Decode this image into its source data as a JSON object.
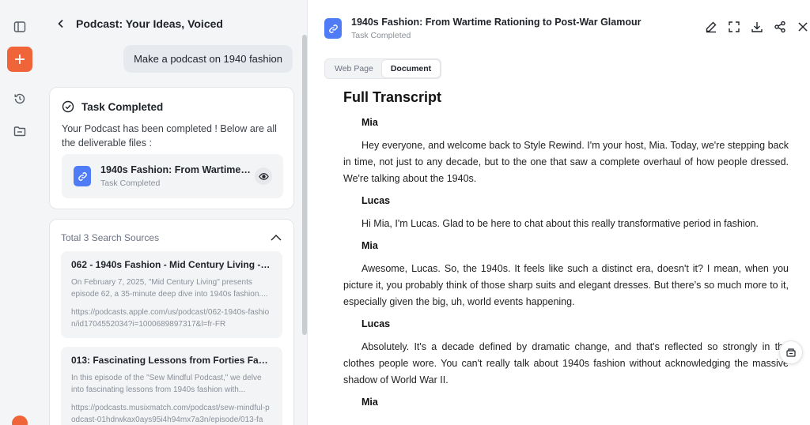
{
  "chat": {
    "title": "Podcast: Your Ideas, Voiced",
    "user_message": "Make a podcast on 1940 fashion",
    "task": {
      "title": "Task Completed",
      "description": "Your Podcast has been completed ! Below are all the deliverable files :",
      "file_name": "1940s Fashion: From Wartime Ra...",
      "file_status": "Task Completed"
    },
    "sources": {
      "header": "Total 3 Search Sources",
      "items": [
        {
          "title": "062 - 1940s Fashion - Mid Century Living - Ap...",
          "snippet": "On February 7, 2025, \"Mid Century Living\" presents episode 62, a 35-minute deep dive into 1940s fashion....",
          "url": "https://podcasts.apple.com/us/podcast/062-1940s-fashion/id1704552034?i=1000689897317&l=fr-FR"
        },
        {
          "title": "013: Fascinating Lessons from Forties Fashion ...",
          "snippet": "In this episode of the \"Sew Mindful Podcast,\" we delve into fascinating lessons from 1940s fashion with...",
          "url": "https://podcasts.musixmatch.com/podcast/sew-mindful-podcast-01hdrwkax0ays95i4h94mx7a3n/episode/013-fa"
        }
      ]
    }
  },
  "doc": {
    "title": "1940s Fashion: From Wartime Rationing to Post-War Glamour",
    "status": "Task Completed",
    "tabs": [
      "Web Page",
      "Document"
    ],
    "heading": "Full Transcript",
    "transcript": [
      {
        "speaker": "Mia",
        "text": "Hey everyone, and welcome back to Style Rewind. I'm your host, Mia. Today, we're stepping back in time, not just to any decade, but to the one that saw a complete overhaul of how people dressed. We're talking about the 1940s."
      },
      {
        "speaker": "Lucas",
        "text": "Hi Mia, I'm Lucas. Glad to be here to chat about this really transformative period in fashion."
      },
      {
        "speaker": "Mia",
        "text": "Awesome, Lucas. So, the 1940s. It feels like such a distinct era, doesn't it? I mean, when you picture it, you probably think of those sharp suits and elegant dresses. But there’s so much more to it, especially given the big, uh, world events happening."
      },
      {
        "speaker": "Lucas",
        "text": "Absolutely. It's a decade defined by dramatic change, and that's reflected so strongly in the clothes people wore. You can't really talk about 1940s fashion without acknowledging the massive shadow of World War II."
      },
      {
        "speaker": "Mia",
        "text": ""
      }
    ]
  },
  "colors": {
    "accent": "#f0643a",
    "file_icon": "#4f7cf6"
  },
  "icons": [
    "sidebar-toggle-icon",
    "plus-icon",
    "history-icon",
    "folder-icon",
    "back-icon",
    "check-circle-icon",
    "file-link-icon",
    "eye-icon",
    "chevron-up-icon",
    "edit-icon",
    "fullscreen-icon",
    "download-icon",
    "share-icon",
    "close-icon",
    "feedback-icon"
  ]
}
